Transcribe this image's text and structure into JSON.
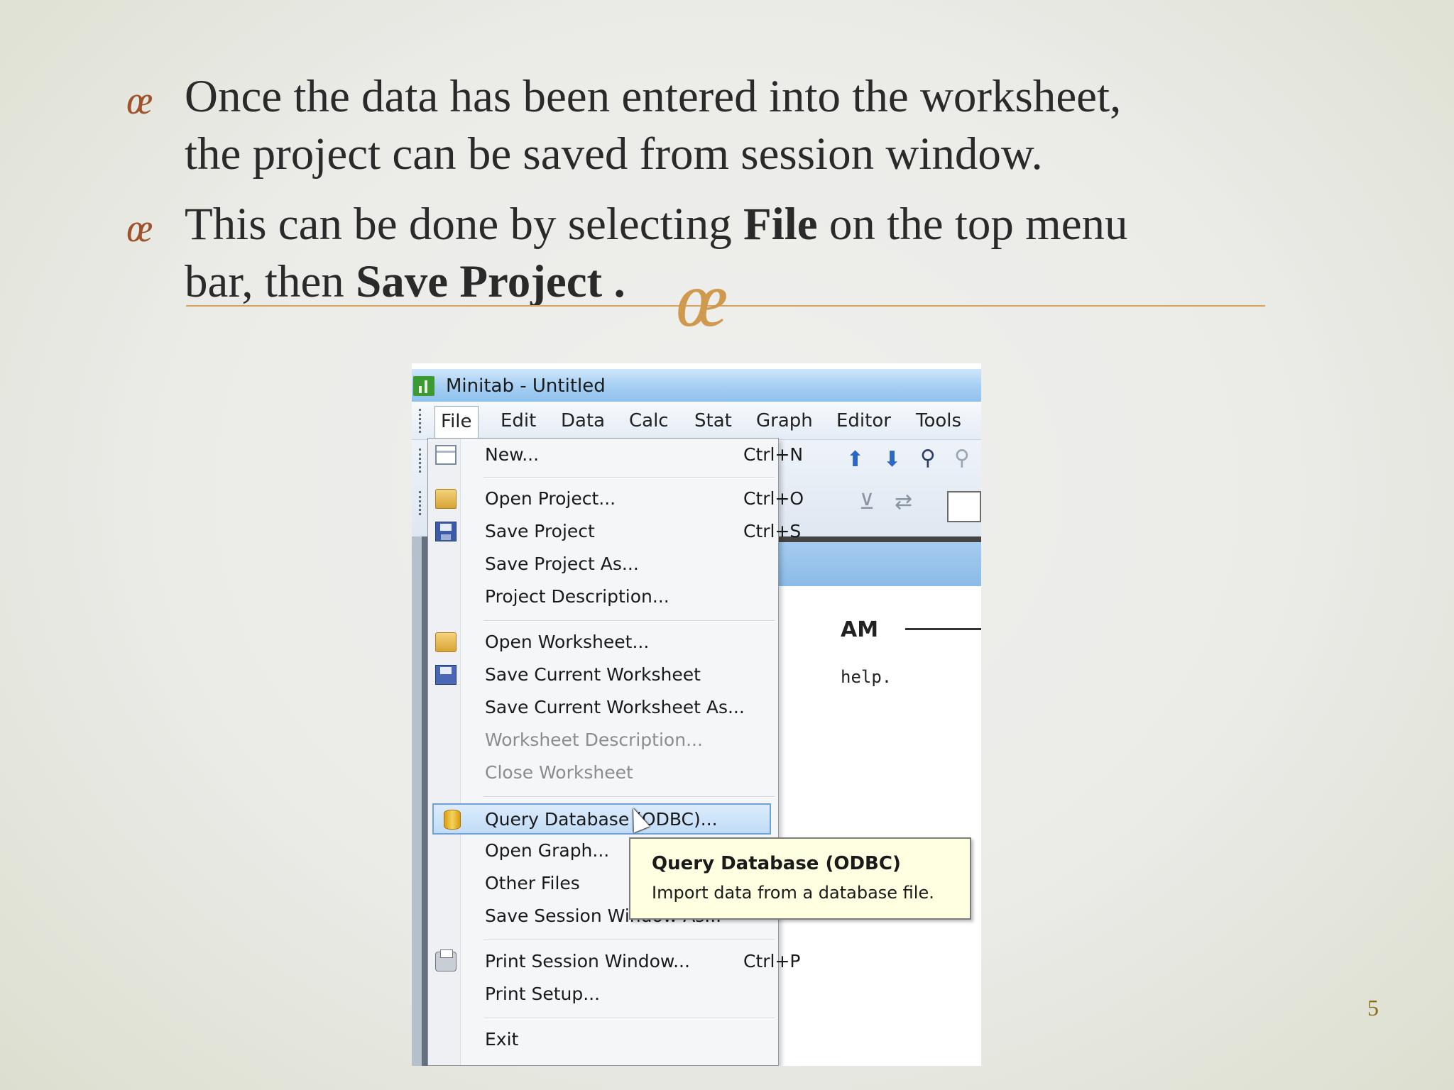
{
  "slide": {
    "bullet_glyph": "œ",
    "bullets": [
      {
        "lines": [
          "Once the data has been entered  into the worksheet,",
          "the project can be saved from session window."
        ]
      },
      {
        "prefix": "This can be done by selecting ",
        "bold1": "File",
        "middle": " on the top menu",
        "line2_prefix": "bar, then ",
        "bold2": "Save Project",
        "suffix": " ."
      }
    ],
    "page_number": "5"
  },
  "window": {
    "title": "Minitab - Untitled",
    "menus": [
      "File",
      "Edit",
      "Data",
      "Calc",
      "Stat",
      "Graph",
      "Editor",
      "Tools"
    ],
    "session_text": {
      "heading": "AM",
      "help": "help."
    }
  },
  "file_menu": {
    "items": [
      {
        "label": "New...",
        "shortcut": "Ctrl+N"
      },
      {
        "label": "Open Project...",
        "shortcut": "Ctrl+O"
      },
      {
        "label": "Save Project",
        "shortcut": "Ctrl+S"
      },
      {
        "label": "Save Project As...",
        "shortcut": ""
      },
      {
        "label": "Project Description...",
        "shortcut": ""
      },
      {
        "label": "Open Worksheet...",
        "shortcut": ""
      },
      {
        "label": "Save Current Worksheet",
        "shortcut": ""
      },
      {
        "label": "Save Current Worksheet As...",
        "shortcut": ""
      },
      {
        "label": "Worksheet Description...",
        "shortcut": ""
      },
      {
        "label": "Close Worksheet",
        "shortcut": ""
      },
      {
        "label": "Query Database (ODBC)...",
        "shortcut": ""
      },
      {
        "label": "Open Graph...",
        "shortcut": ""
      },
      {
        "label": "Other Files",
        "shortcut": ""
      },
      {
        "label": "Save Session Window As...",
        "shortcut": ""
      },
      {
        "label": "Print Session Window...",
        "shortcut": "Ctrl+P"
      },
      {
        "label": "Print Setup...",
        "shortcut": ""
      },
      {
        "label": "Exit",
        "shortcut": ""
      }
    ]
  },
  "tooltip": {
    "title": "Query Database (ODBC)",
    "description": "Import data from a database file."
  },
  "colors": {
    "bullet": "#a0522d",
    "accent_rule": "#d9a15a",
    "highlight": "#c1dcf6",
    "tooltip_bg": "#ffffe1"
  }
}
